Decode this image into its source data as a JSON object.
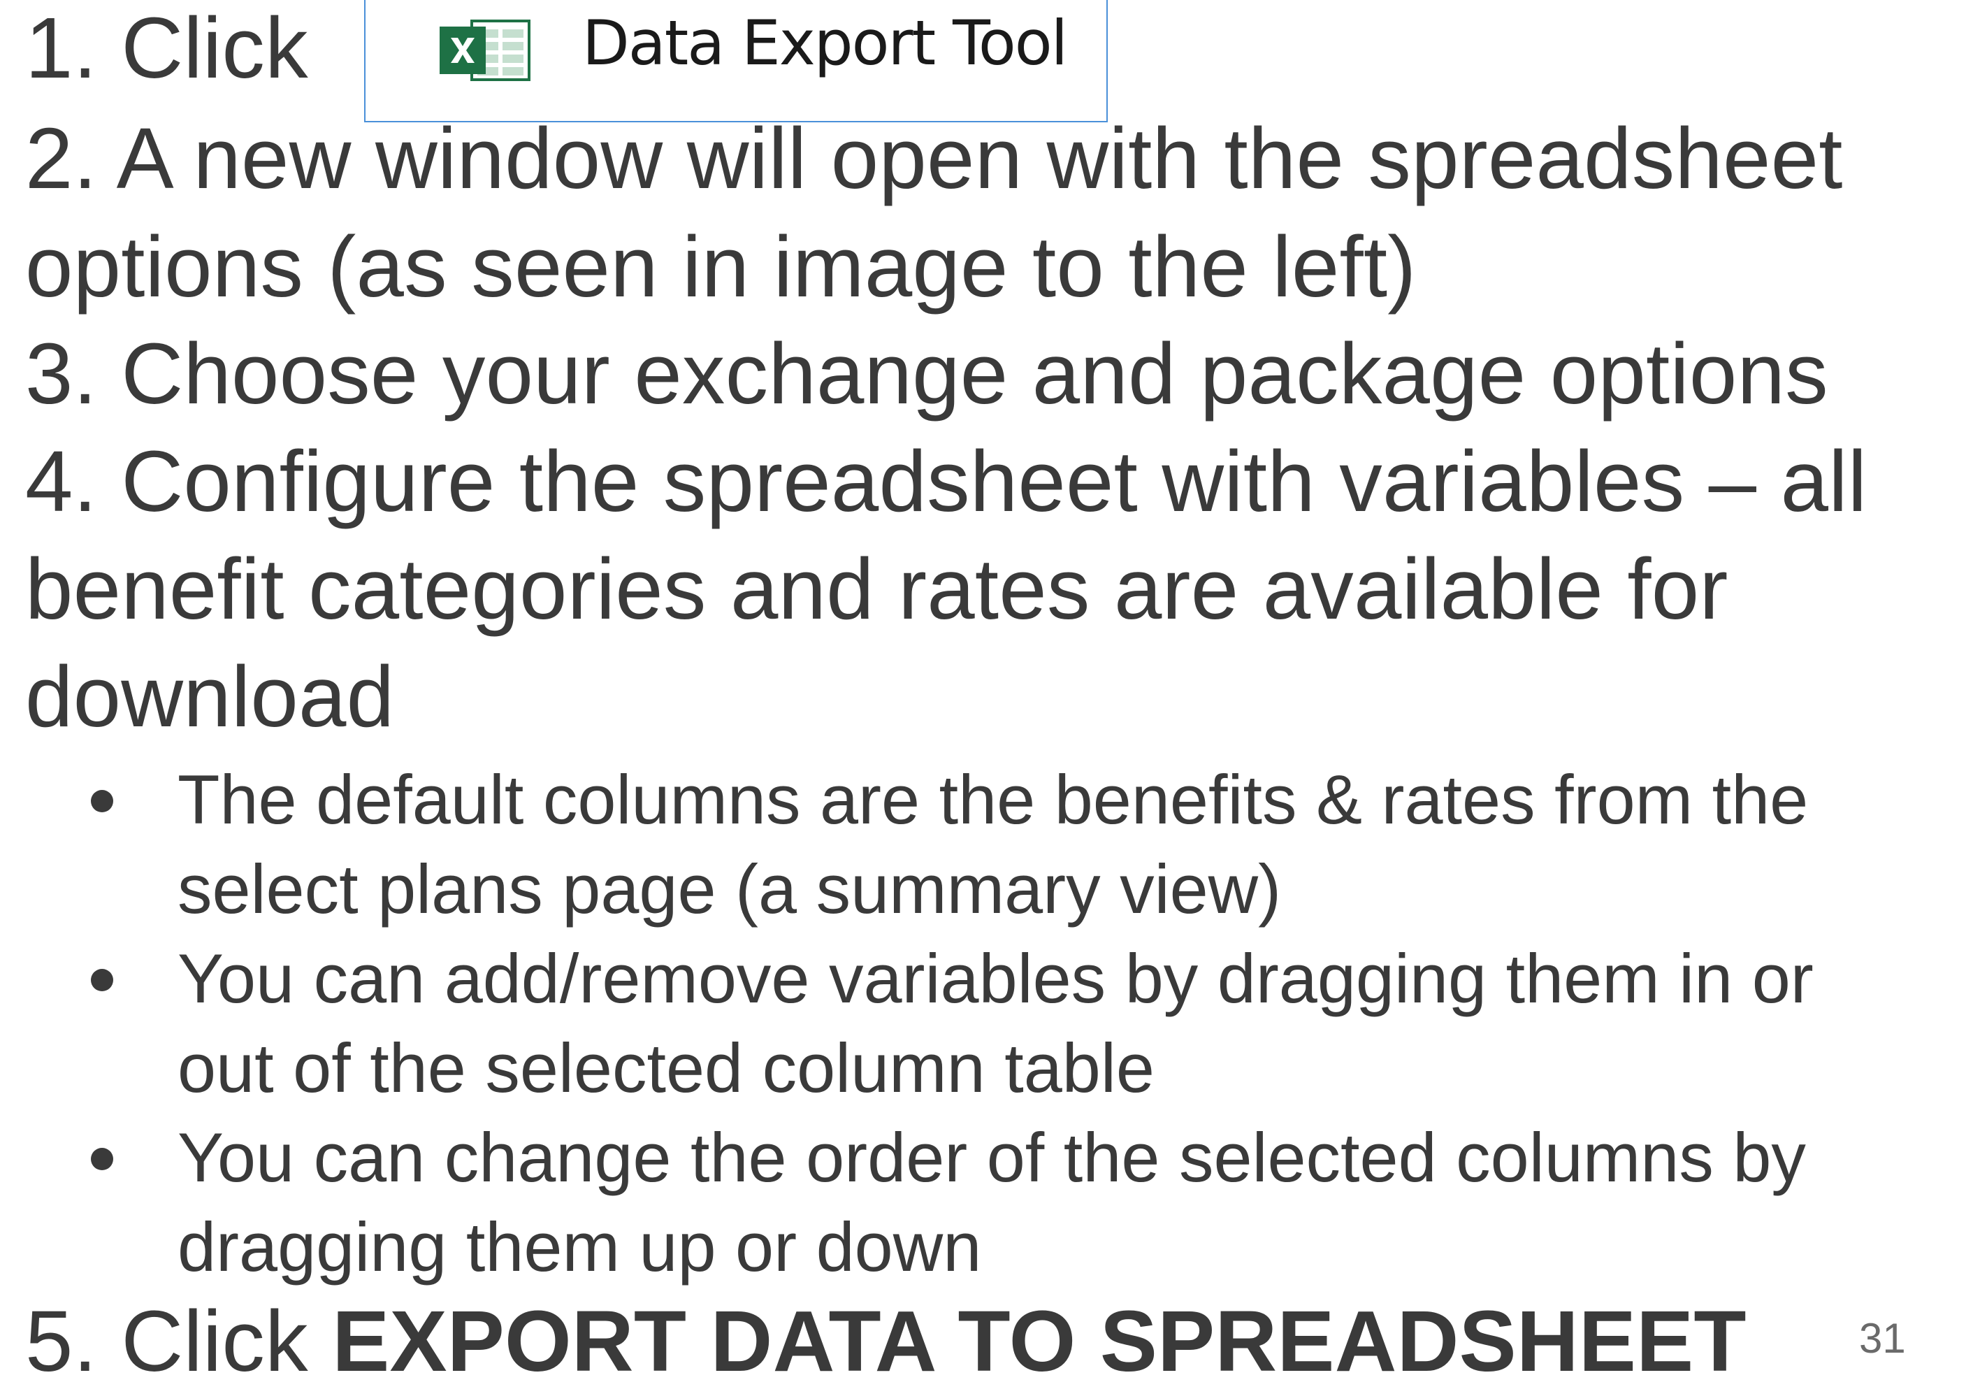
{
  "step1": {
    "prefix": "1. Click",
    "button_label": "Data Export Tool",
    "button_icon": "excel-icon"
  },
  "step2": {
    "line1": "2. A new window will open with the spreadsheet",
    "line2": "options (as seen in image to the left)"
  },
  "step3": {
    "line1": "3. Choose your exchange and package options"
  },
  "step4": {
    "line1": "4. Configure the spreadsheet with variables – all",
    "line2": "benefit categories and rates are available for",
    "line3": "download",
    "bullets": [
      {
        "line1": "The default columns are the benefits & rates from the",
        "line2": "select plans page (a summary view)"
      },
      {
        "line1": "You can add/remove variables by dragging them in or",
        "line2": "out of the selected column table"
      },
      {
        "line1": "You can change the order of the selected columns by",
        "line2": "dragging them up or down"
      }
    ]
  },
  "step5": {
    "prefix": "5. Click ",
    "bold": "EXPORT DATA TO SPREADSHEET"
  },
  "page_number": "31",
  "colors": {
    "text": "#3a3a3a",
    "button_border": "#4a90d9",
    "excel_green": "#1e7145"
  }
}
